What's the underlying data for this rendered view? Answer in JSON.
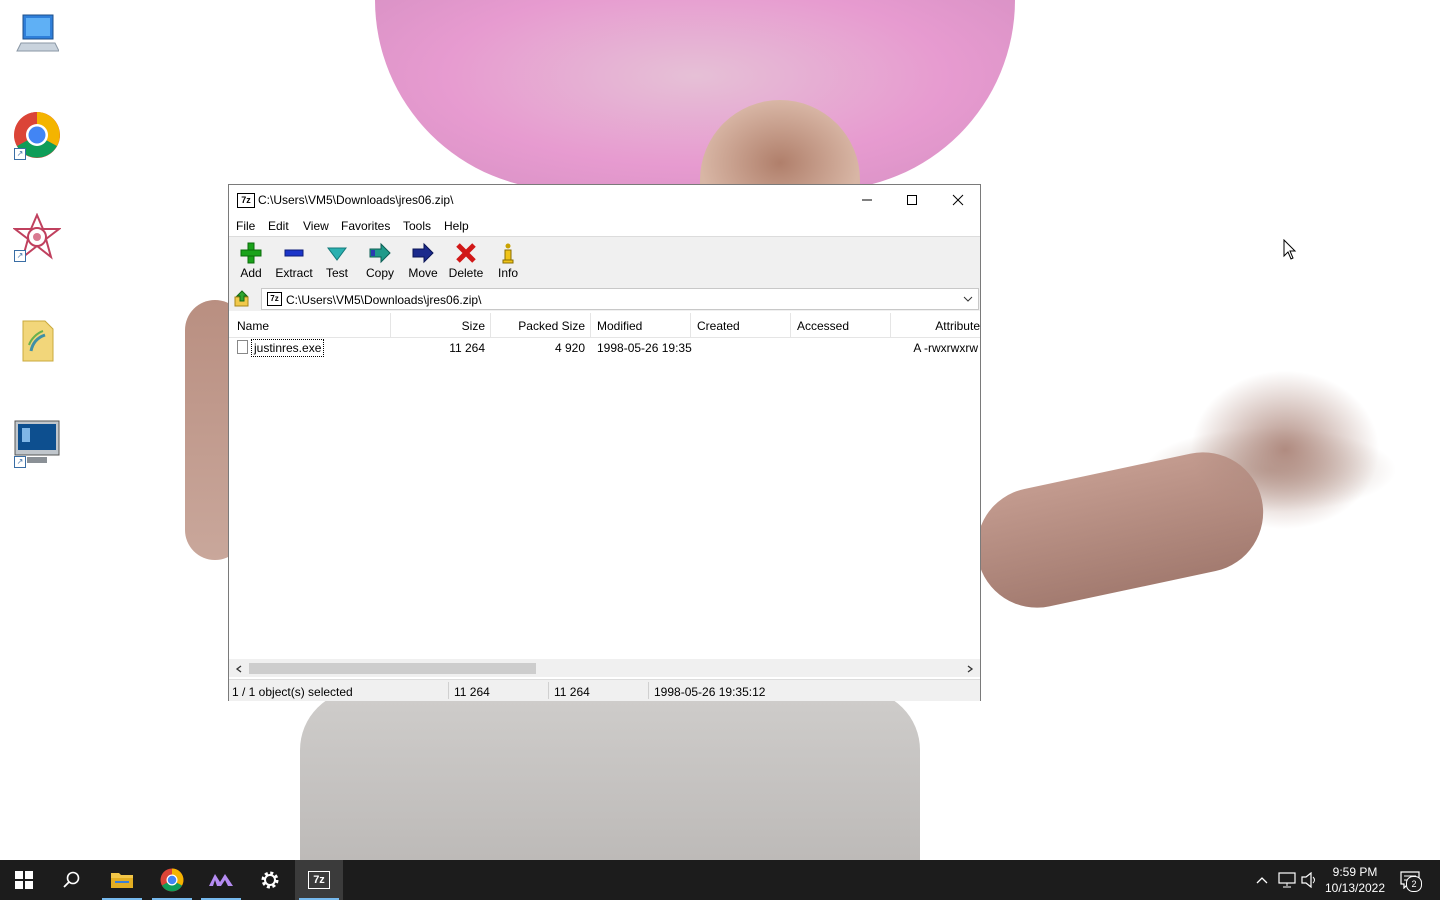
{
  "desktop": {
    "icons": [
      {
        "name": "this-pc-icon"
      },
      {
        "name": "chrome-shortcut-icon"
      },
      {
        "name": "app-shortcut-icon"
      },
      {
        "name": "folder-shortcut-icon"
      },
      {
        "name": "remote-desktop-shortcut-icon"
      }
    ]
  },
  "window": {
    "app_icon_text": "7z",
    "title": "C:\\Users\\VM5\\Downloads\\jres06.zip\\",
    "menu": [
      "File",
      "Edit",
      "View",
      "Favorites",
      "Tools",
      "Help"
    ],
    "toolbar": {
      "add": "Add",
      "extract": "Extract",
      "test": "Test",
      "copy": "Copy",
      "move": "Move",
      "delete": "Delete",
      "info": "Info"
    },
    "address": {
      "icon_text": "7z",
      "path": "C:\\Users\\VM5\\Downloads\\jres06.zip\\"
    },
    "columns": {
      "name": "Name",
      "size": "Size",
      "packed_size": "Packed Size",
      "modified": "Modified",
      "created": "Created",
      "accessed": "Accessed",
      "attributes": "Attribute"
    },
    "files": [
      {
        "name": "justinres.exe",
        "size": "11 264",
        "packed_size": "4 920",
        "modified": "1998-05-26 19:35",
        "created": "",
        "accessed": "",
        "attributes": "A -rwxrwxrw"
      }
    ],
    "status": {
      "selection": "1 / 1 object(s) selected",
      "size": "11 264",
      "total": "11 264",
      "modified": "1998-05-26 19:35:12"
    }
  },
  "taskbar": {
    "apps": [
      "start",
      "search",
      "file-explorer",
      "chrome",
      "app",
      "settings",
      "7zip"
    ],
    "active_app": "7zip",
    "app_7zip_text": "7z",
    "clock_time": "9:59 PM",
    "clock_date": "10/13/2022",
    "notification_count": "2"
  },
  "colors": {
    "taskbar": "#1c1c1c",
    "accent": "#76b9ed",
    "add_green": "#1aa31a",
    "delete_red": "#d11818",
    "test_teal": "#2ab0b0",
    "move_navy": "#1b2a8c"
  }
}
